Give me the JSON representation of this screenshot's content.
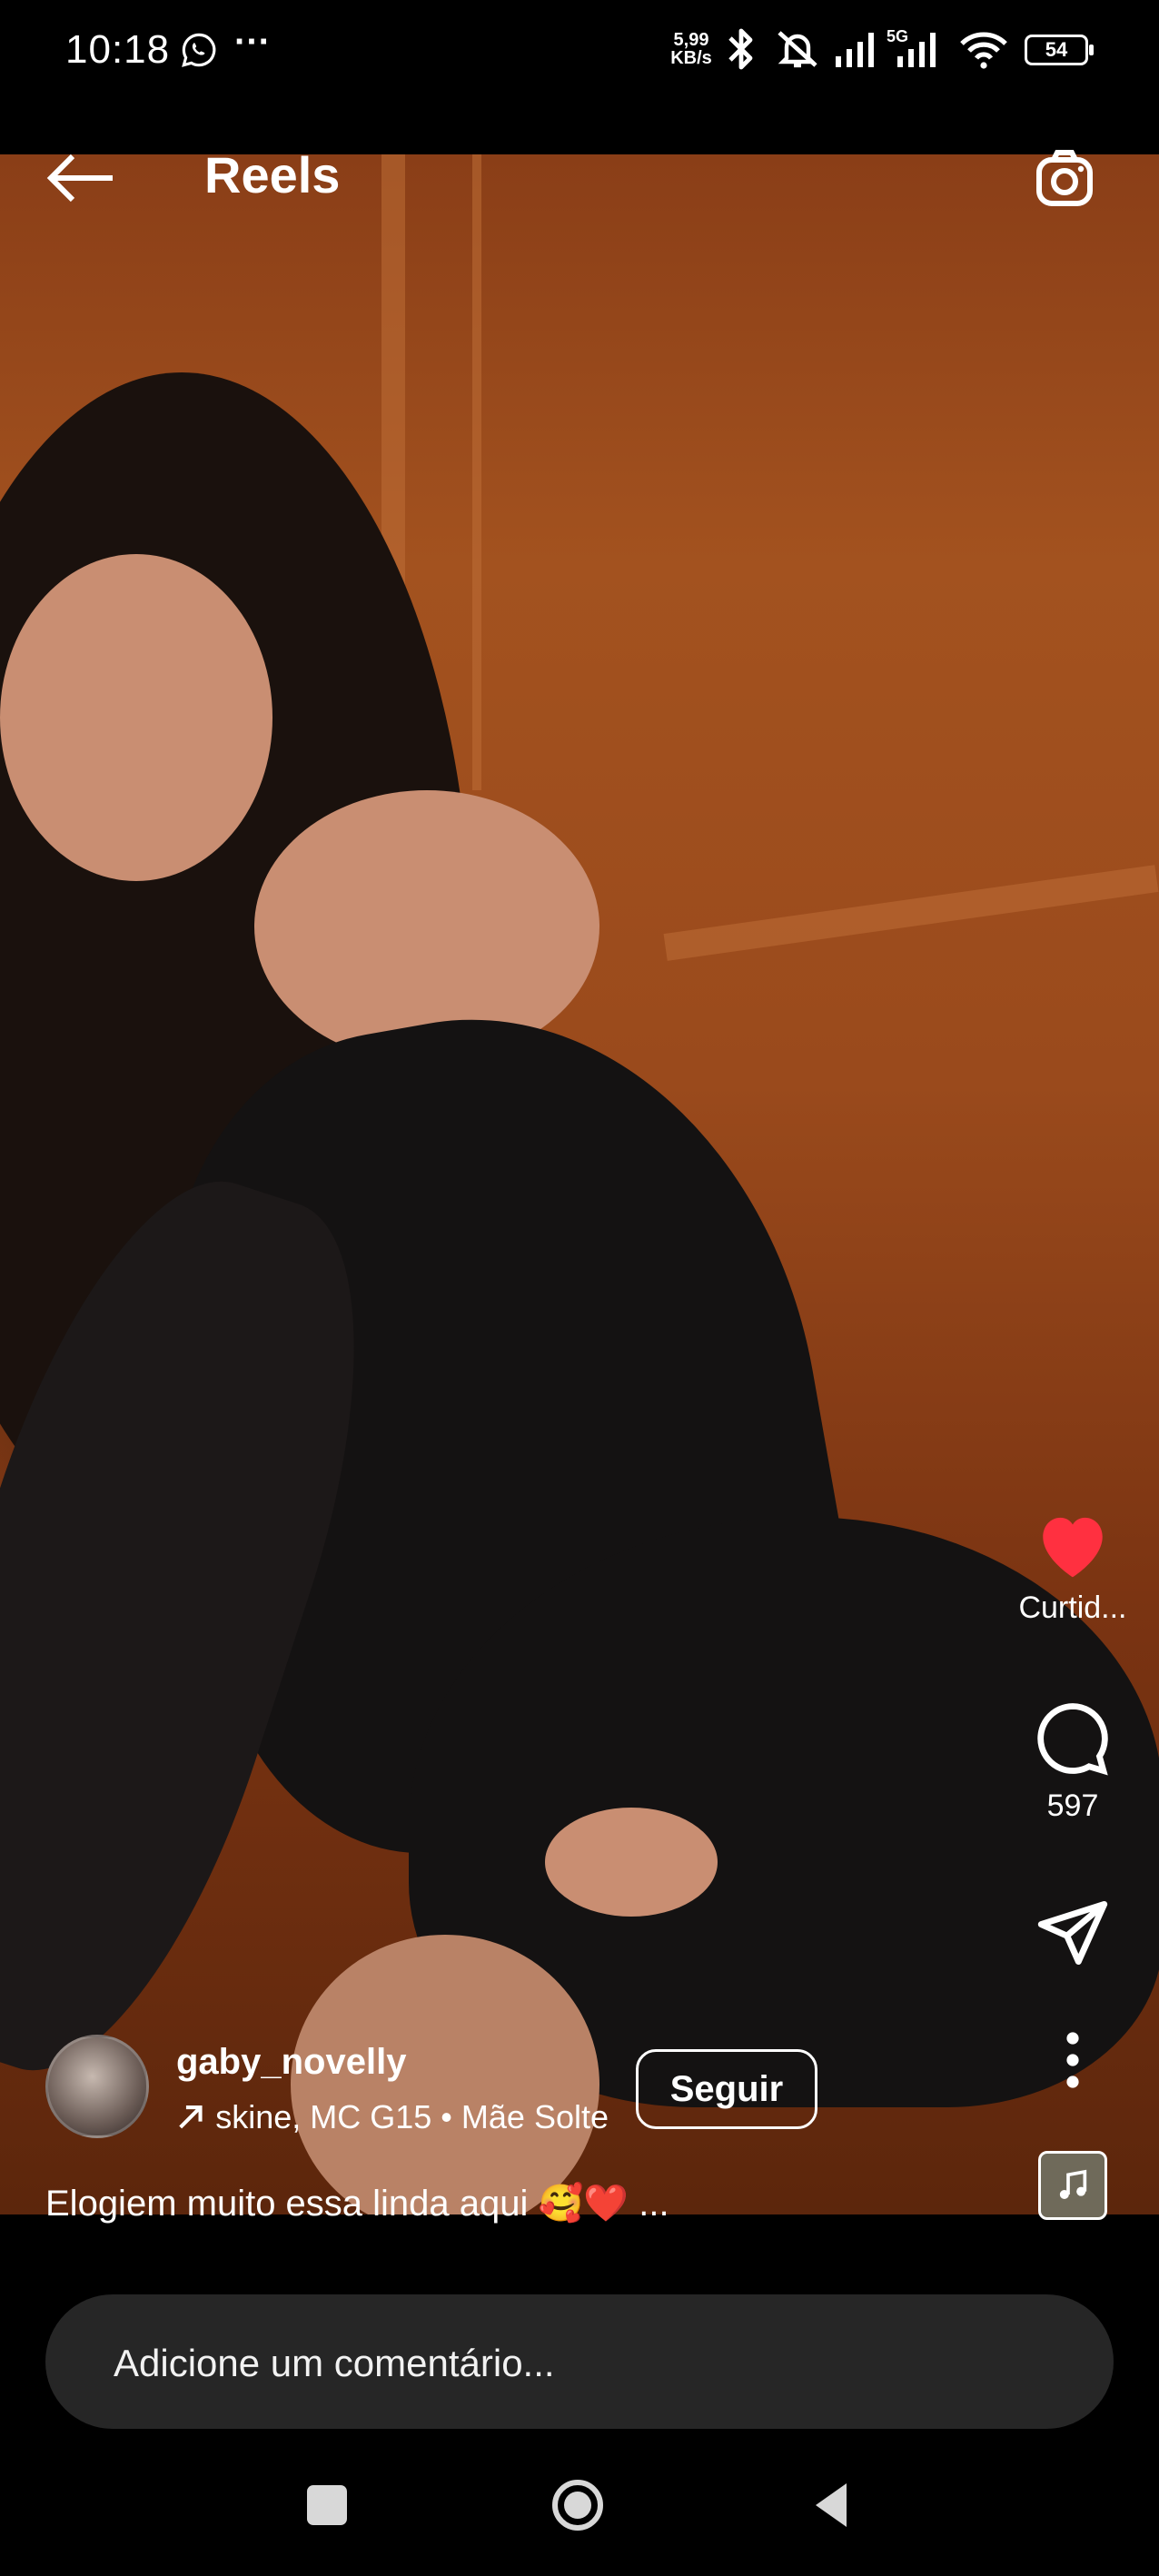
{
  "status_bar": {
    "time": "10:18",
    "net_speed_value": "5,99",
    "net_speed_unit": "KB/s",
    "network_label": "5G",
    "battery": "54"
  },
  "header": {
    "title": "Reels"
  },
  "actions": {
    "like_label": "Curtid...",
    "comment_count": "597"
  },
  "post": {
    "username": "gaby_novelly",
    "audio_info": "skine, MC G15 • Mãe Solte",
    "follow_label": "Seguir",
    "caption": "Elogiem muito essa linda aqui 🥰❤️ ..."
  },
  "comment_bar": {
    "placeholder": "Adicione um comentário..."
  },
  "colors": {
    "like_red": "#ff3040",
    "comment_bar_bg": "#262626",
    "background": "#000000"
  },
  "icons": [
    "whatsapp-icon",
    "more-dots-icon",
    "bluetooth-icon",
    "mute-icon",
    "signal-icon",
    "wifi-icon",
    "battery-icon",
    "back-arrow-icon",
    "camera-icon",
    "heart-icon",
    "comment-icon",
    "share-icon",
    "more-vertical-icon",
    "music-icon",
    "arrow-up-right-icon"
  ]
}
